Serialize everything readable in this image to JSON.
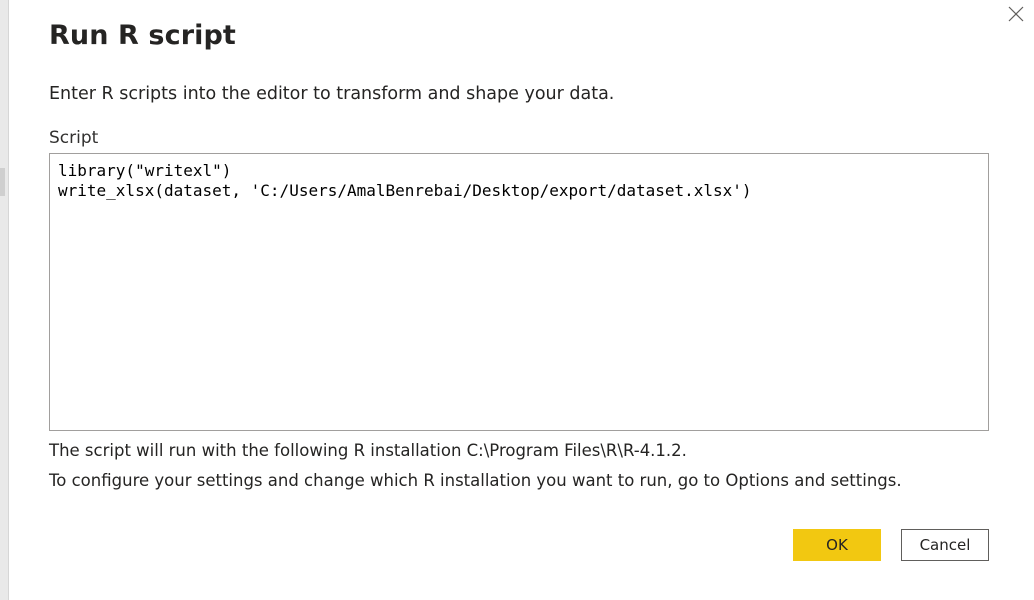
{
  "dialog": {
    "title": "Run R script",
    "description": "Enter R scripts into the editor to transform and shape your data.",
    "script_label": "Script",
    "script_lines": [
      "library(\"writexl\")",
      "write_xlsx(dataset, 'C:/Users/AmalBenrebai/Desktop/export/dataset.xlsx')"
    ],
    "info_installation": "The script will run with the following R installation C:\\Program Files\\R\\R-4.1.2.",
    "info_configure": "To configure your settings and change which R installation you want to run, go to Options and settings.",
    "ok_label": "OK",
    "cancel_label": "Cancel",
    "close_icon": "close-icon"
  },
  "colors": {
    "accent": "#f2c811",
    "text": "#252423",
    "border": "#a19f9d"
  }
}
